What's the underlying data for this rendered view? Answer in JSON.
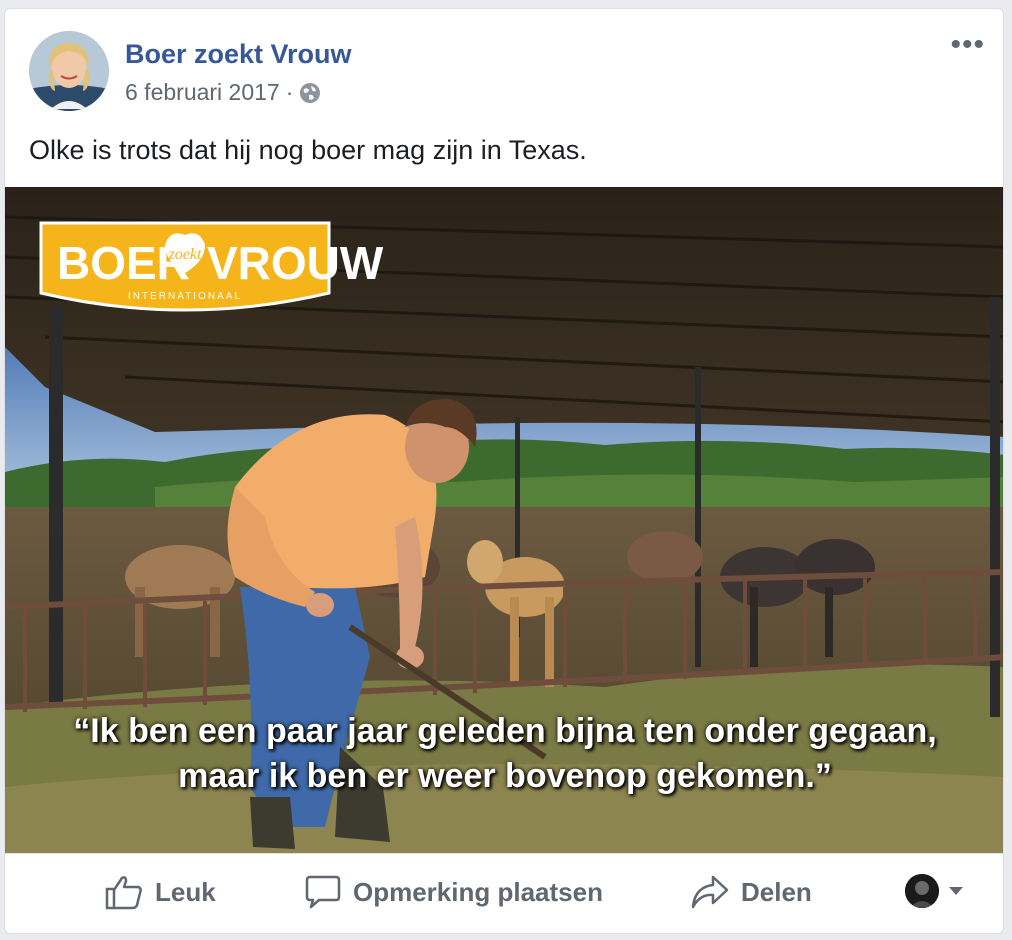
{
  "post": {
    "page_name": "Boer zoekt Vrouw",
    "date": "6 februari 2017",
    "separator": "·",
    "privacy_icon": "globe-icon",
    "text": "Olke is trots dat hij nog boer mag zijn in Texas."
  },
  "image": {
    "logo_word_left": "BOER",
    "logo_word_middle": "zoekt",
    "logo_word_right": "VROUW",
    "logo_subtitle": "INTERNATIONAAL",
    "quote_line1": "“Ik ben een paar jaar geleden bijna ten onder gegaan,",
    "quote_line2": "maar ik ben er weer bovenop gekomen.”"
  },
  "actions": {
    "like_label": "Leuk",
    "comment_label": "Opmerking plaatsen",
    "share_label": "Delen"
  },
  "colors": {
    "link_blue": "#365899",
    "muted": "#606770",
    "logo_yellow": "#f4b41a"
  }
}
